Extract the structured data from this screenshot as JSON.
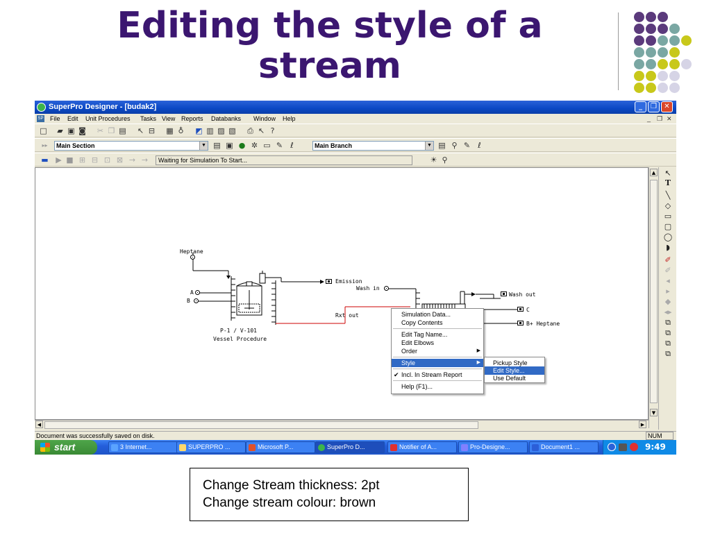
{
  "slide": {
    "title": "Editing the style of a stream",
    "note_line1": "Change Stream thickness: 2pt",
    "note_line2": "Change stream colour: brown"
  },
  "window": {
    "title": "SuperPro Designer - [budak2]",
    "min_glyph": "_",
    "max_glyph": "❐",
    "close_glyph": "✕"
  },
  "menubar": {
    "items": [
      "File",
      "Edit",
      "Unit Procedures",
      "Tasks",
      "View",
      "Reports",
      "Databanks",
      "Window",
      "Help"
    ],
    "mdi_min": "_",
    "mdi_restore": "❐",
    "mdi_close": "✕"
  },
  "toolbar2": {
    "section_value": "Main Section",
    "branch_value": "Main Branch"
  },
  "toolbar3": {
    "status_text": "Waiting for Simulation To Start..."
  },
  "flowsheet": {
    "heptane_label": "Heptane",
    "input_a": "A",
    "input_b": "B",
    "emission_label": "Emission",
    "wash_in_label": "Wash in",
    "rxt_out_label": "Rxt out",
    "wash_out_label": "Wash out",
    "c_label": "C",
    "b_heptane_label": "B+ Heptane",
    "vessel_id": "P-1 / V-101",
    "vessel_desc": "Vessel Procedure",
    "stream_color": "#cc0000"
  },
  "context_menu": {
    "items": [
      "Simulation Data...",
      "Copy Contents",
      "Edit Tag Name...",
      "Edit Elbows",
      "Order",
      "Style",
      "Incl. In Stream Report",
      "Help (F1)..."
    ],
    "submenu": [
      "Pickup Style",
      "Edit Style...",
      "Use Default"
    ]
  },
  "statusbar": {
    "message": "Document was successfully saved on disk.",
    "num": "NUM"
  },
  "taskbar": {
    "start": "start",
    "tasks": [
      "3 Internet...",
      "SUPERPRO ...",
      "Microsoft P...",
      "SuperPro D...",
      "Notifier of A...",
      "Pro-Designe...",
      "Document1 ..."
    ],
    "clock": "9:49"
  },
  "colors": {
    "title": "#3b1670",
    "dot_purple": "#5b3a7c",
    "dot_teal": "#7aa7a3",
    "dot_yellow": "#c8c81a",
    "dot_light": "#d6d4e6",
    "menu_highlight": "#316ac5"
  }
}
